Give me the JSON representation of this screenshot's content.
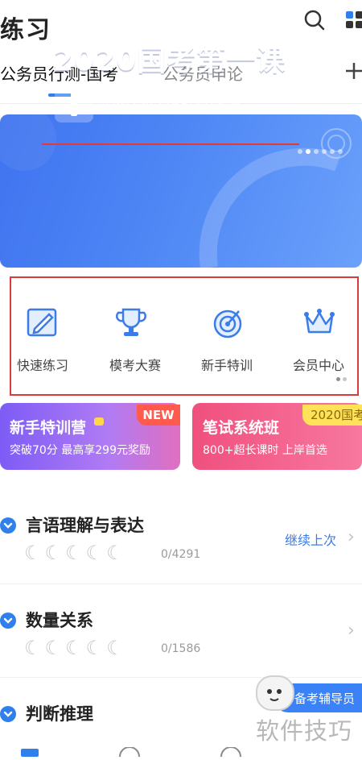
{
  "header": {
    "title": "练习",
    "search_icon": "search-icon",
    "apps_icon": "grid-icon"
  },
  "tabs": [
    {
      "label": "公务员行测-国考",
      "active": true
    },
    {
      "label": "公务员申论",
      "active": false
    }
  ],
  "add_icon": "plus-icon",
  "banner": {
    "title": "2020国考第一课",
    "subtitle": "行测申论 免费的上岸建议",
    "colors": {
      "start": "#3f73f0",
      "end": "#6aa1fb"
    }
  },
  "quick_actions": [
    {
      "label": "快速练习",
      "icon": "edit-icon"
    },
    {
      "label": "模考大赛",
      "icon": "trophy-icon"
    },
    {
      "label": "新手特训",
      "icon": "target-icon"
    },
    {
      "label": "会员中心",
      "icon": "crown-icon"
    }
  ],
  "promos": [
    {
      "title": "新手特训营",
      "subtitle": "突破70分 最高享299元奖励",
      "badge": "NEW"
    },
    {
      "title": "笔试系统班",
      "subtitle": "800+超长课时 上岸首选",
      "badge": "2020国考"
    }
  ],
  "sections": [
    {
      "title": "言语理解与表达",
      "count": "0/4291",
      "action": "继续上次"
    },
    {
      "title": "数量关系",
      "count": "0/1586"
    },
    {
      "title": "判断推理"
    }
  ],
  "floating": {
    "label": "备考辅导员"
  },
  "watermark": "软件技巧",
  "accent_color": "#2f80ed"
}
